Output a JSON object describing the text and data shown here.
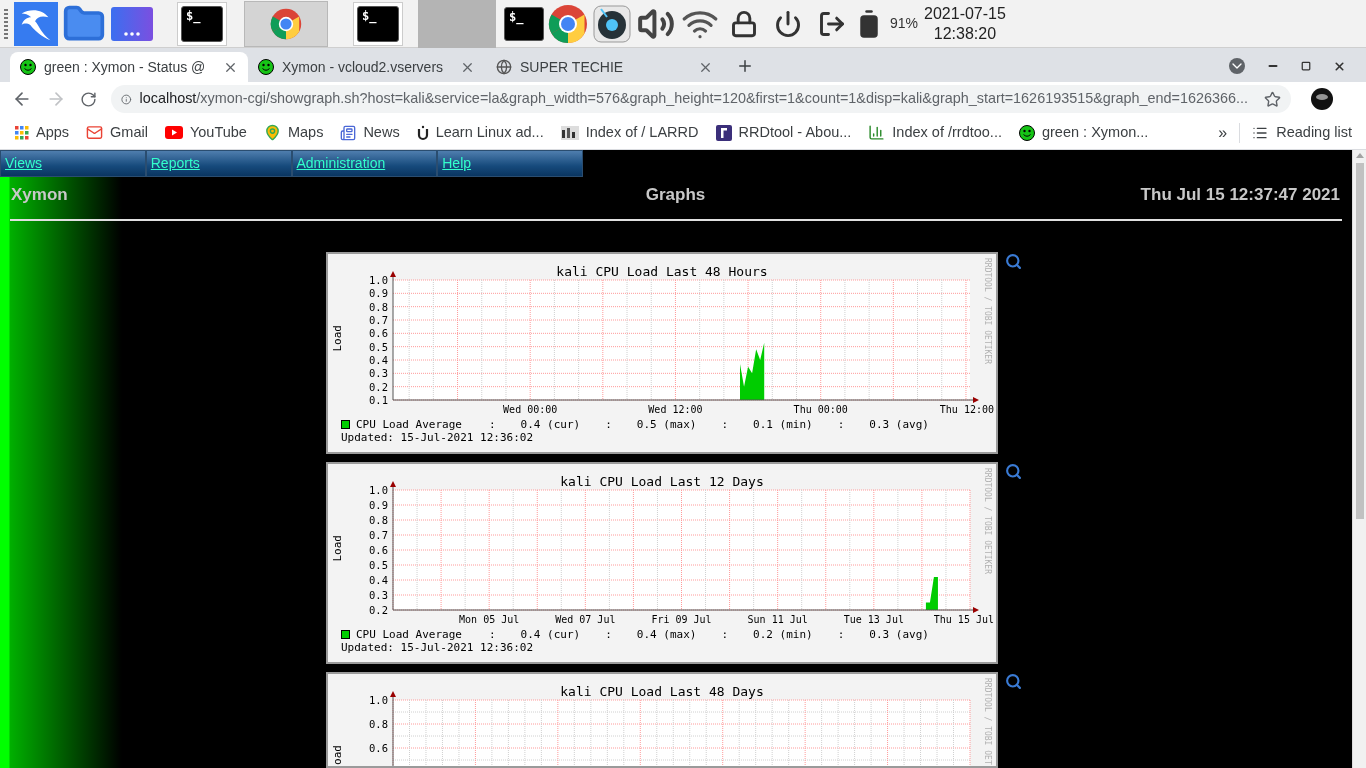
{
  "taskbar": {
    "launchers": [
      {
        "kind": "kali"
      },
      {
        "kind": "folder"
      },
      {
        "kind": "apps"
      }
    ],
    "tasks": [
      {
        "kind": "terminal",
        "glyph": "$_",
        "selected": false
      },
      {
        "kind": "chrome",
        "selected": true
      },
      {
        "kind": "terminal",
        "glyph": "$_",
        "selected": false
      }
    ],
    "tray": [
      {
        "kind": "terminal",
        "glyph": "$_"
      },
      {
        "kind": "chrome"
      },
      {
        "kind": "media"
      },
      {
        "kind": "volume"
      },
      {
        "kind": "wifi"
      },
      {
        "kind": "lock"
      },
      {
        "kind": "power"
      },
      {
        "kind": "logout"
      },
      {
        "kind": "battery"
      }
    ],
    "battery": "91%",
    "date": "2021-07-15",
    "time": "12:38:20"
  },
  "browser": {
    "tabs": [
      {
        "title": "green : Xymon - Status @",
        "kind": "xymon",
        "selected": true
      },
      {
        "title": "Xymon - vcloud2.vservers",
        "kind": "xymon",
        "selected": false
      },
      {
        "title": "SUPER TECHIE",
        "kind": "globe",
        "selected": false
      }
    ],
    "url": {
      "host": "localhost",
      "path": "/xymon-cgi/showgraph.sh?host=kali&service=la&graph_width=576&graph_height=120&first=1&count=1&disp=kali&graph_start=1626193515&graph_end=1626366..."
    },
    "bookmarks": [
      {
        "label": "Apps",
        "kind": "apps"
      },
      {
        "label": "Gmail",
        "kind": "mail"
      },
      {
        "label": "YouTube",
        "kind": "youtube"
      },
      {
        "label": "Maps",
        "kind": "maps"
      },
      {
        "label": "News",
        "kind": "news"
      },
      {
        "label": "Learn Linux ad...",
        "kind": "linux"
      },
      {
        "label": "Index of / LARRD",
        "kind": "larrd"
      },
      {
        "label": "RRDtool - Abou...",
        "kind": "rrd"
      },
      {
        "label": "Index of /rrdtoo...",
        "kind": "chart"
      },
      {
        "label": "green : Xymon...",
        "kind": "xymon"
      }
    ],
    "overflow": "»",
    "reading_list": "Reading list"
  },
  "page": {
    "menu": [
      "Views",
      "Reports",
      "Administration",
      "Help"
    ],
    "brand": "Xymon",
    "title": "Graphs",
    "timestamp": "Thu Jul 15 12:37:47 2021",
    "graphs": [
      {
        "watermark": "RRDTOOL / TOBI OETIKER",
        "legend": [
          ":",
          "0.4 (cur)",
          ":",
          "0.5 (max)",
          ":",
          "0.1 (min)",
          ":",
          "0.3 (avg)"
        ],
        "updated": "Updated: 15-Jul-2021 12:36:02",
        "chart_data": {
          "type": "area",
          "title": "kali CPU Load Last 48 Hours",
          "ylabel": "Load",
          "grid": true,
          "ylim": [
            0.1,
            1.0
          ],
          "yticks": [
            {
              "value": 0.1,
              "label": "0.1"
            },
            {
              "value": 0.2,
              "label": "0.2"
            },
            {
              "value": 0.3,
              "label": "0.3"
            },
            {
              "value": 0.4,
              "label": "0.4"
            },
            {
              "value": 0.5,
              "label": "0.5"
            },
            {
              "value": 0.6,
              "label": "0.6"
            },
            {
              "value": 0.7,
              "label": "0.7"
            },
            {
              "value": 0.8,
              "label": "0.8"
            },
            {
              "value": 0.9,
              "label": "0.9"
            },
            {
              "value": 1.0,
              "label": "1.0"
            }
          ],
          "categories": [
            null,
            null,
            null,
            null,
            null,
            null,
            null,
            null,
            null,
            null,
            null,
            null,
            null,
            null,
            null,
            null,
            null,
            null,
            null,
            null,
            null,
            null,
            null,
            null,
            null,
            null,
            null,
            null,
            null,
            null,
            null,
            null,
            null,
            null,
            "Wed 00:00",
            null,
            null,
            null,
            null,
            null,
            null,
            null,
            null,
            null,
            null,
            null,
            null,
            null,
            null,
            null,
            null,
            null,
            null,
            null,
            null,
            null,
            null,
            null,
            null,
            null,
            null,
            null,
            null,
            null,
            null,
            null,
            null,
            null,
            null,
            null,
            "Wed 12:00",
            null,
            null,
            null,
            null,
            null,
            null,
            null,
            null,
            null,
            null,
            null,
            null,
            null,
            null,
            null,
            null,
            null,
            null,
            null,
            null,
            null,
            null,
            null,
            null,
            null,
            null,
            null,
            null,
            null,
            null,
            null,
            null,
            null,
            null,
            null,
            "Thu 00:00",
            null,
            null,
            null,
            null,
            null,
            null,
            null,
            null,
            null,
            null,
            null,
            null,
            null,
            null,
            null,
            null,
            null,
            null,
            null,
            null,
            null,
            null,
            null,
            null,
            null,
            null,
            null,
            null,
            null,
            null,
            null,
            null,
            null,
            null,
            null,
            "Thu 12:00",
            null
          ],
          "series": [
            {
              "name": "CPU Load Average",
              "color": "#00cc00",
              "values": [
                null,
                null,
                null,
                null,
                null,
                null,
                null,
                null,
                null,
                null,
                null,
                null,
                null,
                null,
                null,
                null,
                null,
                null,
                null,
                null,
                null,
                null,
                null,
                null,
                null,
                null,
                null,
                null,
                null,
                null,
                null,
                null,
                null,
                null,
                null,
                null,
                null,
                null,
                null,
                null,
                null,
                null,
                null,
                null,
                null,
                null,
                null,
                null,
                null,
                null,
                null,
                null,
                null,
                null,
                null,
                null,
                null,
                null,
                null,
                null,
                null,
                null,
                null,
                null,
                null,
                null,
                null,
                null,
                null,
                null,
                null,
                null,
                null,
                null,
                null,
                null,
                null,
                null,
                null,
                null,
                null,
                null,
                null,
                null,
                null,
                null,
                0.37,
                0.2,
                0.35,
                0.3,
                0.48,
                0.4,
                0.53,
                null,
                null,
                null,
                null,
                null,
                null,
                null,
                null,
                null,
                null,
                null,
                null,
                null,
                null,
                null,
                null,
                null,
                null,
                null,
                null,
                null,
                null,
                null,
                null,
                null,
                null,
                null,
                null,
                null,
                null,
                null,
                null,
                null,
                null,
                null,
                null,
                null,
                null,
                null,
                null,
                null,
                null,
                null,
                null,
                null,
                null,
                null,
                null,
                null,
                null,
                null
              ]
            }
          ]
        }
      },
      {
        "watermark": "RRDTOOL / TOBI OETIKER",
        "legend": [
          ":",
          "0.4 (cur)",
          ":",
          "0.4 (max)",
          ":",
          "0.2 (min)",
          ":",
          "0.3 (avg)"
        ],
        "updated": "Updated: 15-Jul-2021 12:36:02",
        "chart_data": {
          "type": "area",
          "title": "kali CPU Load Last 12 Days",
          "ylabel": "Load",
          "grid": true,
          "ylim": [
            0.2,
            1.0
          ],
          "yticks": [
            {
              "value": 0.2,
              "label": "0.2"
            },
            {
              "value": 0.3,
              "label": "0.3"
            },
            {
              "value": 0.4,
              "label": "0.4"
            },
            {
              "value": 0.5,
              "label": "0.5"
            },
            {
              "value": 0.6,
              "label": "0.6"
            },
            {
              "value": 0.7,
              "label": "0.7"
            },
            {
              "value": 0.8,
              "label": "0.8"
            },
            {
              "value": 0.9,
              "label": "0.9"
            },
            {
              "value": 1.0,
              "label": "1.0"
            }
          ],
          "categories": [
            null,
            null,
            null,
            null,
            null,
            null,
            null,
            null,
            null,
            null,
            null,
            null,
            null,
            null,
            null,
            null,
            null,
            null,
            null,
            null,
            null,
            null,
            null,
            null,
            "Mon 05 Jul",
            null,
            null,
            null,
            null,
            null,
            null,
            null,
            null,
            null,
            null,
            null,
            null,
            null,
            null,
            null,
            null,
            null,
            null,
            null,
            null,
            null,
            null,
            null,
            "Wed 07 Jul",
            null,
            null,
            null,
            null,
            null,
            null,
            null,
            null,
            null,
            null,
            null,
            null,
            null,
            null,
            null,
            null,
            null,
            null,
            null,
            null,
            null,
            null,
            null,
            "Fri 09 Jul",
            null,
            null,
            null,
            null,
            null,
            null,
            null,
            null,
            null,
            null,
            null,
            null,
            null,
            null,
            null,
            null,
            null,
            null,
            null,
            null,
            null,
            null,
            null,
            "Sun 11 Jul",
            null,
            null,
            null,
            null,
            null,
            null,
            null,
            null,
            null,
            null,
            null,
            null,
            null,
            null,
            null,
            null,
            null,
            null,
            null,
            null,
            null,
            null,
            null,
            "Tue 13 Jul",
            null,
            null,
            null,
            null,
            null,
            null,
            null,
            null,
            null,
            null,
            null,
            null,
            null,
            null,
            null,
            null,
            null,
            null,
            null,
            null,
            null,
            null,
            null,
            "Thu 15 Jul"
          ],
          "series": [
            {
              "name": "CPU Load Average",
              "color": "#00cc00",
              "values": [
                null,
                null,
                null,
                null,
                null,
                null,
                null,
                null,
                null,
                null,
                null,
                null,
                null,
                null,
                null,
                null,
                null,
                null,
                null,
                null,
                null,
                null,
                null,
                null,
                null,
                null,
                null,
                null,
                null,
                null,
                null,
                null,
                null,
                null,
                null,
                null,
                null,
                null,
                null,
                null,
                null,
                null,
                null,
                null,
                null,
                null,
                null,
                null,
                null,
                null,
                null,
                null,
                null,
                null,
                null,
                null,
                null,
                null,
                null,
                null,
                null,
                null,
                null,
                null,
                null,
                null,
                null,
                null,
                null,
                null,
                null,
                null,
                null,
                null,
                null,
                null,
                null,
                null,
                null,
                null,
                null,
                null,
                null,
                null,
                null,
                null,
                null,
                null,
                null,
                null,
                null,
                null,
                null,
                null,
                null,
                null,
                null,
                null,
                null,
                null,
                null,
                null,
                null,
                null,
                null,
                null,
                null,
                null,
                null,
                null,
                null,
                null,
                null,
                null,
                null,
                null,
                null,
                null,
                null,
                null,
                null,
                null,
                null,
                null,
                null,
                null,
                null,
                null,
                null,
                null,
                null,
                null,
                null,
                0.25,
                0.25,
                0.42,
                0.42,
                null,
                null,
                null,
                null,
                null,
                null,
                null,
                null
              ]
            }
          ]
        }
      },
      {
        "watermark": "RRDTOOL / TOBI OET",
        "title": "kali CPU Load Last 48 Days",
        "ylabel": "oad",
        "tick_labels": [
          "1.0",
          "0.8",
          "0.6"
        ]
      }
    ]
  }
}
